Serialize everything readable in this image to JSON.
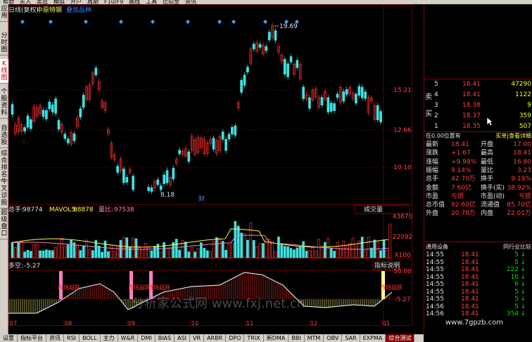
{
  "toolbar": {
    "items": [
      "帮助",
      "买入",
      "卖出",
      "模拟",
      "开户",
      "周期",
      "F10/F9",
      "画线",
      "工具",
      "比较金",
      "资讯"
    ]
  },
  "sidebar": {
    "tabs": [
      "应用",
      "分时图",
      "K线图",
      "个股资料",
      "自选股",
      "综合排名",
      "牛叉诊股",
      "超级盘口"
    ]
  },
  "chart": {
    "header": {
      "mode": "日线(复权)",
      "name": "中原特钢",
      "tag": "叠加品种"
    },
    "price_axis": [
      "15.21",
      "12.66",
      "10.10"
    ],
    "high_marker": "19.69",
    "low_marker": "8.18",
    "event_marker": "财",
    "volume_header": {
      "total_label": "总手:",
      "total_value": "98774",
      "mavol_label": "MAVOL5:",
      "mavol_value": "88878",
      "ratio_label": "量比:",
      "ratio_value": "97538"
    },
    "volume_dropdown": "成交量",
    "volume_axis": [
      "43670",
      "22092",
      "X100"
    ],
    "indicator_header": {
      "label": "多空:",
      "value": "-5.27"
    },
    "indicator_button": "指标说明",
    "indicator_axis": [
      "50.00",
      "-5.27"
    ],
    "indicator_signal": "市场超跌",
    "watermark": "分析家公式网 www.fxj.net.cn",
    "x_labels": [
      "07",
      "08",
      "09",
      "10",
      "11",
      "12",
      "01"
    ],
    "colors": {
      "up": "#ff3030",
      "down": "#40e0e0",
      "signal": "#ff80c0"
    }
  },
  "bottom_tabs": [
    "设置",
    "指标平台",
    "资讯",
    "RSI",
    "BOLL",
    "主力",
    "W&R",
    "DMI",
    "BIAS",
    "ASI",
    "VR",
    "ARBR",
    "DPO",
    "TRIX",
    "新DMA",
    "BBI",
    "MTM",
    "OBV",
    "SAR",
    "EXPMA",
    "综合测试"
  ],
  "orderbook": {
    "sell_label": "卖",
    "buy_label": "买",
    "sell": [
      {
        "n": "5",
        "p": "18.41",
        "v": "47290"
      },
      {
        "n": "4",
        "p": "18.41",
        "v": "1122"
      },
      {
        "n": "3",
        "p": "18.38",
        "v": "9"
      },
      {
        "n": "2",
        "p": "18.37",
        "v": "359"
      },
      {
        "n": "1",
        "p": "18.35",
        "v": "507"
      }
    ],
    "header_left": "在0.00位置有",
    "header_right": "买单|查看详细",
    "stats": [
      {
        "l1": "最新",
        "v1": "18.41",
        "l2": "开盘",
        "v2": "17.00"
      },
      {
        "l1": "涨跌",
        "v1": "+1.67",
        "l2": "最高",
        "v2": "18.41"
      },
      {
        "l1": "涨幅",
        "v1": "+9.98%",
        "l2": "最低",
        "v2": "16.80"
      },
      {
        "l1": "振幅",
        "v1": "9.14%",
        "l2": "量比",
        "v2": "3.23"
      },
      {
        "l1": "总手",
        "v1": "42.70万",
        "l2": "换手",
        "v2": "9.19%"
      },
      {
        "l1": "金额",
        "v1": "7.60亿",
        "l2": "换手(实)",
        "v2": "38.92%"
      },
      {
        "l1": "市盈",
        "v1": "亏损",
        "l2": "市盈(动)",
        "v2": "亏损"
      },
      {
        "l1": "总市值",
        "v1": "92.60亿",
        "l2": "流通值",
        "v2": "85.70亿"
      },
      {
        "l1": "外盘",
        "v1": "20.78万",
        "l2": "内盘",
        "v2": "22.01万"
      }
    ],
    "tab_left": "通用设备",
    "tab_right": "同行业比较",
    "trades": [
      {
        "t": "14:55",
        "p": "18.41",
        "v": "5"
      },
      {
        "t": "14:55",
        "p": "18.41",
        "v": "5"
      },
      {
        "t": "14:55",
        "p": "18.41",
        "v": "222"
      },
      {
        "t": "14:55",
        "p": "18.41",
        "v": "10"
      },
      {
        "t": "14:55",
        "p": "18.41",
        "v": "6"
      },
      {
        "t": "14:55",
        "p": "18.41",
        "v": "5"
      },
      {
        "t": "14:55",
        "p": "18.41",
        "v": "5"
      },
      {
        "t": "14:56",
        "p": "18.41",
        "v": "5"
      },
      {
        "t": "14:56",
        "p": "18.41",
        "v": "354"
      }
    ],
    "website": "www.7gpzb.com"
  }
}
